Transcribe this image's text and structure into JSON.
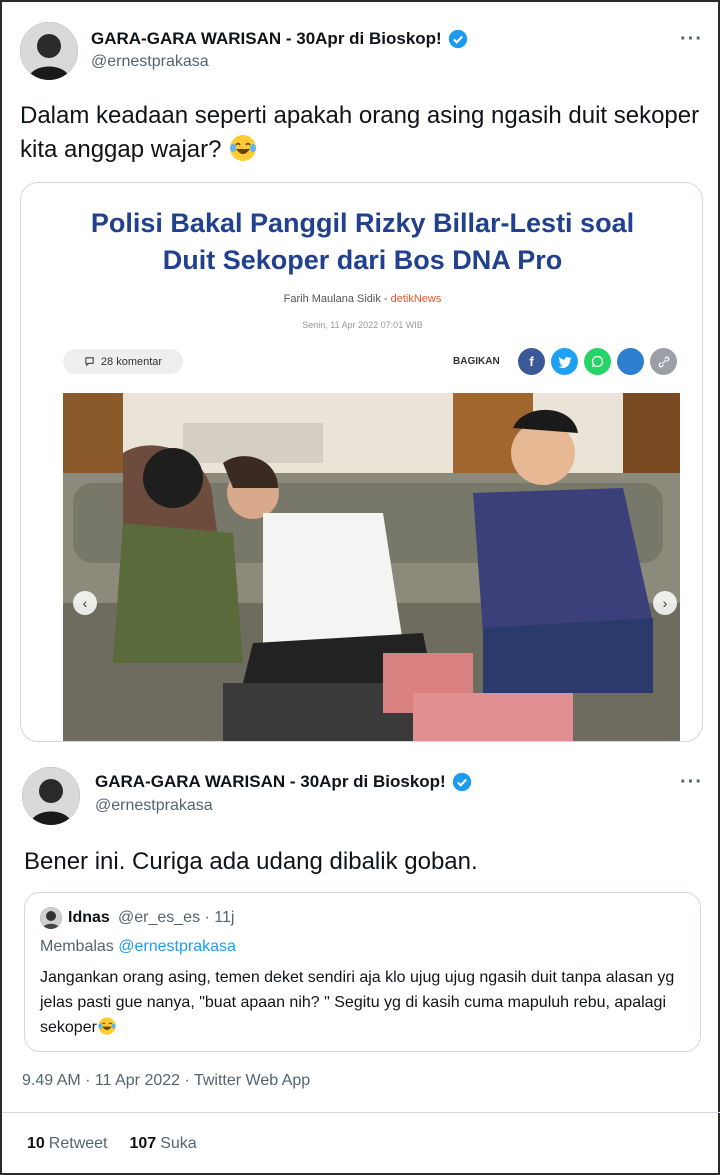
{
  "tweet1": {
    "author_name": "GARA-GARA WARISAN - 30Apr di Bioskop!",
    "handle": "@ernestprakasa",
    "more": "···",
    "text": "Dalam keadaan seperti apakah orang asing ngasih duit sekoper kita anggap wajar?",
    "emoji": "face-with-tears-of-joy-icon"
  },
  "article": {
    "headline_line1": "Polisi Bakal Panggil Rizky Billar-Lesti soal",
    "headline_line2": "Duit Sekoper dari Bos DNA Pro",
    "author": "Farih Maulana Sidik",
    "separator": " - ",
    "source": "detikNews",
    "date": "Senin, 11 Apr 2022 07:01 WIB",
    "comments": "28 komentar",
    "share_label": "BAGIKAN",
    "share_colors": {
      "facebook": "#3b5998",
      "twitter": "#1da1f2",
      "whatsapp": "#25d366",
      "other": "#2f7fd1",
      "link": "#9aa0a6"
    }
  },
  "tweet2": {
    "author_name": "GARA-GARA WARISAN - 30Apr di Bioskop!",
    "handle": "@ernestprakasa",
    "more": "···",
    "text": "Bener ini. Curiga ada udang dibalik goban."
  },
  "quote": {
    "name": "Idnas",
    "handle_time": "@er_es_es · 11j",
    "reply_prefix": "Membalas ",
    "reply_to": "@ernestprakasa",
    "text": "Jangankan orang asing, temen deket sendiri aja klo ujug ujug ngasih duit tanpa alasan yg jelas pasti gue nanya, \"buat apaan nih? \" Segitu yg di kasih cuma mapuluh rebu, apalagi sekoper"
  },
  "meta": {
    "timestamp": "9.49 AM · 11 Apr 2022 · Twitter Web App"
  },
  "stats": {
    "retweets_count": "10",
    "retweets_label": "Retweet",
    "likes_count": "107",
    "likes_label": "Suka"
  },
  "colors": {
    "accent": "#1d9bf0",
    "headline": "#21418f",
    "source": "#e4572e"
  }
}
